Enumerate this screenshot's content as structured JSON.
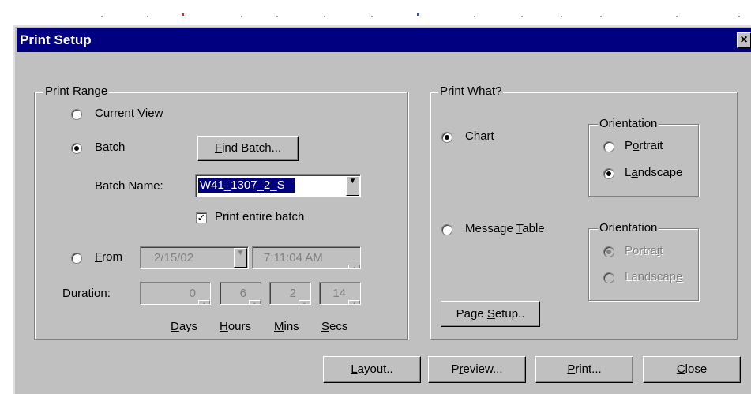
{
  "window": {
    "title": "Print Setup",
    "close_glyph": "×"
  },
  "print_range": {
    "title": "Print Range",
    "current_view": {
      "pre": "Current ",
      "key": "V",
      "post": "iew"
    },
    "batch": {
      "pre": "",
      "key": "B",
      "post": "atch"
    },
    "find_batch": {
      "pre": "",
      "key": "F",
      "post": "ind Batch..."
    },
    "batch_name_label": "Batch Name:",
    "batch_name_value": "W41_1307_2_S",
    "print_entire_batch": "Print entire batch",
    "from": {
      "pre": "",
      "key": "F",
      "post": "rom"
    },
    "from_date": "2/15/02",
    "from_time": "7:11:04 AM",
    "duration_label": "Duration:",
    "duration": {
      "days": "0",
      "hours": "6",
      "mins": "2",
      "secs": "14"
    },
    "units": {
      "days": {
        "key": "D",
        "post": "ays"
      },
      "hours": {
        "key": "H",
        "post": "ours"
      },
      "mins": {
        "key": "M",
        "post": "ins"
      },
      "secs": {
        "key": "S",
        "post": "ecs"
      }
    }
  },
  "print_what": {
    "title": "Print What?",
    "chart": {
      "pre": "Ch",
      "key": "a",
      "post": "rt"
    },
    "message_table": {
      "pre": "Message ",
      "key": "T",
      "post": "able"
    },
    "orientation1": {
      "title": "Orientation",
      "portrait": {
        "pre": "P",
        "key": "o",
        "post": "rtrait"
      },
      "landscape": {
        "pre": "L",
        "key": "a",
        "post": "ndscape"
      }
    },
    "orientation2": {
      "title": "Orientation",
      "portrait": {
        "pre": "Portra",
        "key": "i",
        "post": "t"
      },
      "landscape": {
        "pre": "Landscap",
        "key": "e",
        "post": ""
      }
    },
    "page_setup": {
      "pre": "Page ",
      "key": "S",
      "post": "etup.."
    }
  },
  "buttons": {
    "layout": {
      "pre": "",
      "key": "L",
      "post": "ayout.."
    },
    "preview": {
      "pre": "P",
      "key": "r",
      "post": "eview..."
    },
    "print": {
      "pre": "",
      "key": "P",
      "post": "rint..."
    },
    "close": {
      "pre": "",
      "key": "C",
      "post": "lose"
    }
  },
  "colors": {
    "title_bar": "#000080",
    "face": "#c0c0c0",
    "selection": "#000080"
  }
}
